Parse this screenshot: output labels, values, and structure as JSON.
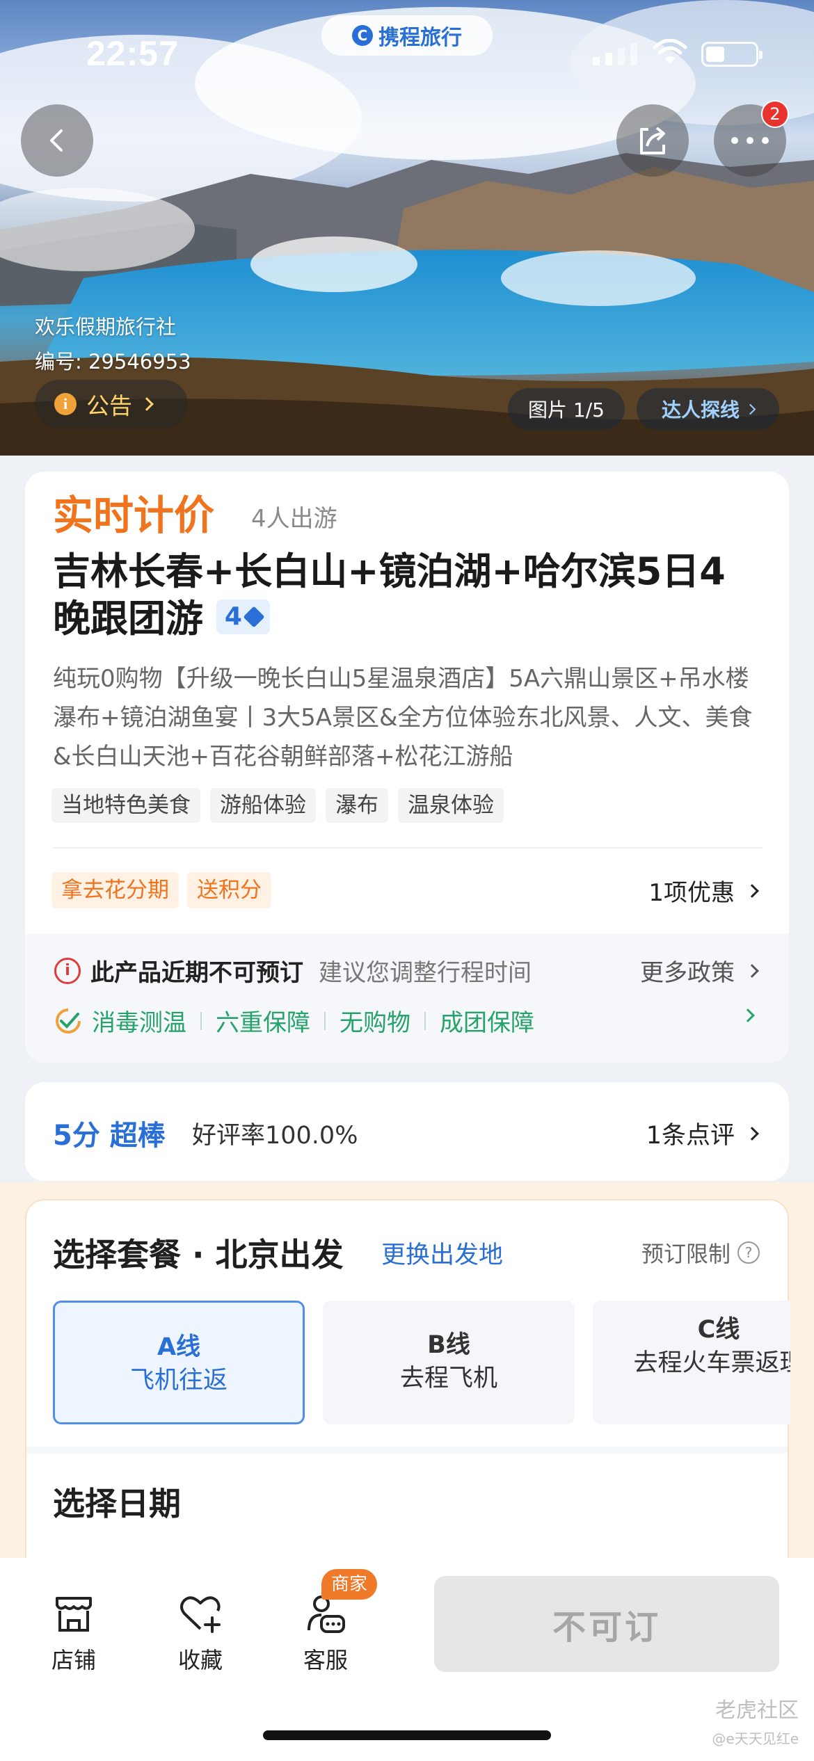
{
  "status_bar": {
    "time": "22:57",
    "brand": "携程旅行"
  },
  "hero": {
    "agency_name": "欢乐假期旅行社",
    "product_id": "编号: 29546953",
    "notice_label": "公告",
    "photo_counter": "图片 1/5",
    "talent_label": "达人探线",
    "more_badge": "2"
  },
  "product": {
    "pricing_label": "实时计价",
    "people": "4人出游",
    "title": "吉林长春+长白山+镜泊湖+哈尔滨5日4晚跟团游",
    "level": "4",
    "description": "纯玩0购物【升级一晚长白山5星温泉酒店】5A六鼎山景区+吊水楼瀑布+镜泊湖鱼宴丨3大5A景区&全方位体验东北风景、人文、美食&长白山天池+百花谷朝鲜部落+松花江游船",
    "tags": [
      "当地特色美食",
      "游船体验",
      "瀑布",
      "温泉体验"
    ],
    "promos": [
      "拿去花分期",
      "送积分"
    ],
    "offer": "1项优惠"
  },
  "policy": {
    "warning_strong": "此产品近期不可预订",
    "warning_soft": "建议您调整行程时间",
    "more": "更多政策",
    "guarantees": [
      "消毒测温",
      "六重保障",
      "无购物",
      "成团保障"
    ]
  },
  "rating": {
    "score": "5分 超棒",
    "good_rate": "好评率100.0%",
    "reviews": "1条点评"
  },
  "package": {
    "title": "选择套餐 · 北京出发",
    "change_origin": "更换出发地",
    "limit": "预订限制",
    "options": [
      {
        "line": "A线",
        "desc": "飞机往返"
      },
      {
        "line": "B线",
        "desc": "去程飞机"
      },
      {
        "line": "C线",
        "desc": "去程火车票返理"
      }
    ],
    "date_title": "选择日期"
  },
  "bottom_bar": {
    "shop": "店铺",
    "favorite": "收藏",
    "service": "客服",
    "merchant_badge": "商家",
    "book_button": "不可订"
  },
  "watermark": {
    "main": "老虎社区",
    "sub": "@e天天见红e"
  },
  "colors": {
    "accent": "#2a6fd6",
    "orange": "#f0731d",
    "green": "#26a36a",
    "warning": "#e23a3a"
  }
}
